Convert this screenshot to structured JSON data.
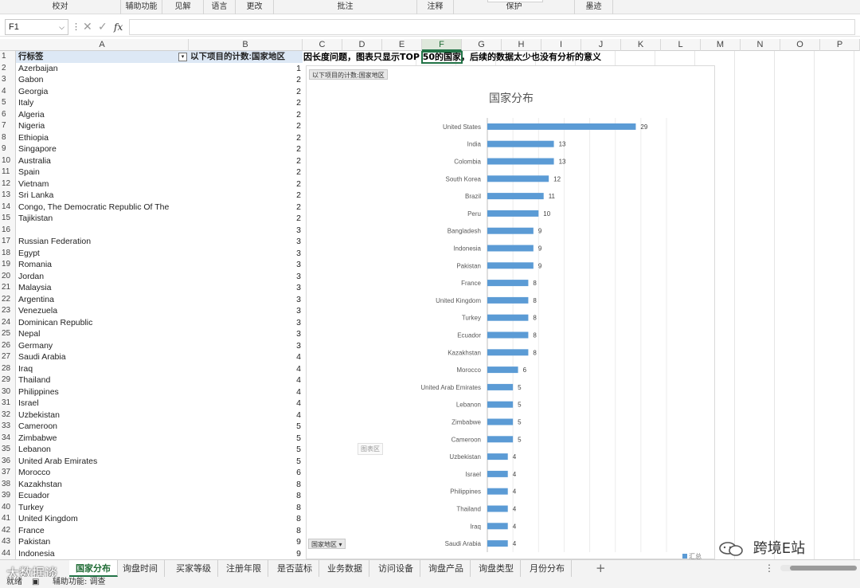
{
  "ribbon": {
    "groups": [
      "校对",
      "辅助功能",
      "见解",
      "语言",
      "更改",
      "批注",
      "注释",
      "保护",
      "墨迹"
    ]
  },
  "formula_bar": {
    "name_box": "F1",
    "sep": "⋮",
    "cancel": "✕",
    "enter": "✓",
    "fx": "fx",
    "value": ""
  },
  "columns": [
    "A",
    "B",
    "C",
    "D",
    "E",
    "F",
    "G",
    "H",
    "I",
    "J",
    "K",
    "L",
    "M",
    "N",
    "O",
    "P"
  ],
  "selected_column": "F",
  "pivot": {
    "header_a": "行标签",
    "header_b": "以下项目的计数:国家地区",
    "rows": [
      {
        "n": "2",
        "country": "Azerbaijan",
        "count": "1"
      },
      {
        "n": "3",
        "country": "Gabon",
        "count": "2"
      },
      {
        "n": "4",
        "country": "Georgia",
        "count": "2"
      },
      {
        "n": "5",
        "country": "Italy",
        "count": "2"
      },
      {
        "n": "6",
        "country": "Algeria",
        "count": "2"
      },
      {
        "n": "7",
        "country": "Nigeria",
        "count": "2"
      },
      {
        "n": "8",
        "country": "Ethiopia",
        "count": "2"
      },
      {
        "n": "9",
        "country": "Singapore",
        "count": "2"
      },
      {
        "n": "10",
        "country": "Australia",
        "count": "2"
      },
      {
        "n": "11",
        "country": "Spain",
        "count": "2"
      },
      {
        "n": "12",
        "country": "Vietnam",
        "count": "2"
      },
      {
        "n": "13",
        "country": "Sri Lanka",
        "count": "2"
      },
      {
        "n": "14",
        "country": "Congo, The Democratic Republic Of The",
        "count": "2"
      },
      {
        "n": "15",
        "country": "Tajikistan",
        "count": "2"
      },
      {
        "n": "16",
        "country": "",
        "count": "3"
      },
      {
        "n": "17",
        "country": "Russian Federation",
        "count": "3"
      },
      {
        "n": "18",
        "country": "Egypt",
        "count": "3"
      },
      {
        "n": "19",
        "country": "Romania",
        "count": "3"
      },
      {
        "n": "20",
        "country": "Jordan",
        "count": "3"
      },
      {
        "n": "21",
        "country": "Malaysia",
        "count": "3"
      },
      {
        "n": "22",
        "country": "Argentina",
        "count": "3"
      },
      {
        "n": "23",
        "country": "Venezuela",
        "count": "3"
      },
      {
        "n": "24",
        "country": "Dominican Republic",
        "count": "3"
      },
      {
        "n": "25",
        "country": "Nepal",
        "count": "3"
      },
      {
        "n": "26",
        "country": "Germany",
        "count": "3"
      },
      {
        "n": "27",
        "country": "Saudi Arabia",
        "count": "4"
      },
      {
        "n": "28",
        "country": "Iraq",
        "count": "4"
      },
      {
        "n": "29",
        "country": "Thailand",
        "count": "4"
      },
      {
        "n": "30",
        "country": "Philippines",
        "count": "4"
      },
      {
        "n": "31",
        "country": "Israel",
        "count": "4"
      },
      {
        "n": "32",
        "country": "Uzbekistan",
        "count": "4"
      },
      {
        "n": "33",
        "country": "Cameroon",
        "count": "5"
      },
      {
        "n": "34",
        "country": "Zimbabwe",
        "count": "5"
      },
      {
        "n": "35",
        "country": "Lebanon",
        "count": "5"
      },
      {
        "n": "36",
        "country": "United Arab Emirates",
        "count": "5"
      },
      {
        "n": "37",
        "country": "Morocco",
        "count": "6"
      },
      {
        "n": "38",
        "country": "Kazakhstan",
        "count": "8"
      },
      {
        "n": "39",
        "country": "Ecuador",
        "count": "8"
      },
      {
        "n": "40",
        "country": "Turkey",
        "count": "8"
      },
      {
        "n": "41",
        "country": "United Kingdom",
        "count": "8"
      },
      {
        "n": "42",
        "country": "France",
        "count": "8"
      },
      {
        "n": "43",
        "country": "Pakistan",
        "count": "9"
      },
      {
        "n": "44",
        "country": "Indonesia",
        "count": "9"
      }
    ]
  },
  "note": "因长度问题，图表只显示TOP 50的国家，后续的数据太少也没有分析的意义",
  "chart": {
    "field_button": "以下项目的计数:国家地区",
    "area_tag": "图表区",
    "axis_field_button": "国家地区",
    "legend_label": "汇总"
  },
  "chart_data": {
    "type": "bar",
    "orientation": "horizontal",
    "title": "国家分布",
    "categories": [
      "United States",
      "India",
      "Colombia",
      "South Korea",
      "Brazil",
      "Peru",
      "Bangladesh",
      "Indonesia",
      "Pakistan",
      "France",
      "United Kingdom",
      "Turkey",
      "Ecuador",
      "Kazakhstan",
      "Morocco",
      "United Arab Emirates",
      "Lebanon",
      "Zimbabwe",
      "Cameroon",
      "Uzbekistan",
      "Israel",
      "Philippines",
      "Thailand",
      "Iraq",
      "Saudi Arabia"
    ],
    "values": [
      29,
      13,
      13,
      12,
      11,
      10,
      9,
      9,
      9,
      8,
      8,
      8,
      8,
      8,
      6,
      5,
      5,
      5,
      5,
      4,
      4,
      4,
      4,
      4,
      4
    ],
    "xlim": [
      0,
      35
    ],
    "grid": true,
    "bar_color": "#5b9bd5",
    "series": [
      {
        "name": "汇总",
        "values": [
          29,
          13,
          13,
          12,
          11,
          10,
          9,
          9,
          9,
          8,
          8,
          8,
          8,
          8,
          6,
          5,
          5,
          5,
          5,
          4,
          4,
          4,
          4,
          4,
          4
        ]
      }
    ]
  },
  "sheet_tabs": {
    "tabs": [
      "国家分布",
      "询盘时间",
      "买家等级",
      "注册年限",
      "是否蓝标",
      "业务数据",
      "访问设备",
      "询盘产品",
      "询盘类型",
      "月份分布"
    ],
    "active": "国家分布",
    "add": "+",
    "more": "⋮"
  },
  "status": {
    "ready": "就绪",
    "accessibility": "辅助功能: 调查"
  },
  "watermarks": {
    "right": "跨境E站",
    "left": "大数据谈"
  }
}
